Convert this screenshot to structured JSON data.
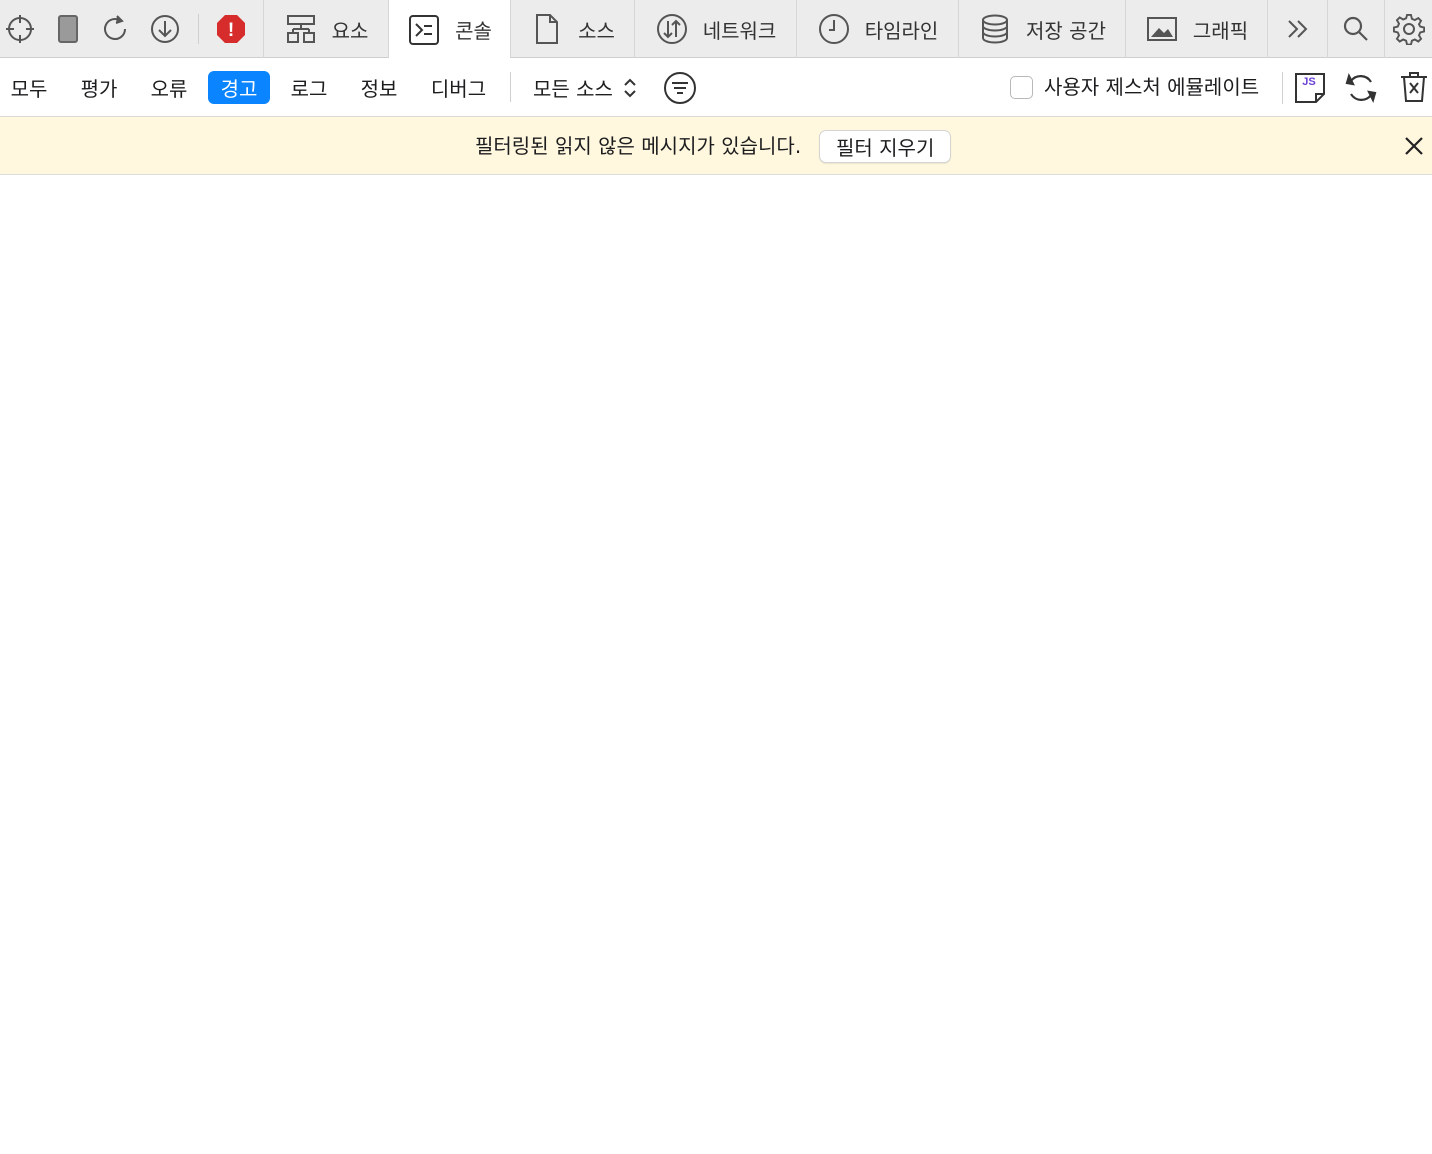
{
  "toolbar": {
    "icons": [
      "crosshair-icon",
      "device-icon",
      "reload-icon",
      "download-icon",
      "error-badge-icon"
    ],
    "error_badge": "!"
  },
  "tabs": [
    {
      "id": "elements",
      "label": "요소",
      "icon": "elements-icon"
    },
    {
      "id": "console",
      "label": "콘솔",
      "icon": "console-icon",
      "active": true
    },
    {
      "id": "sources",
      "label": "소스",
      "icon": "sources-icon"
    },
    {
      "id": "network",
      "label": "네트워크",
      "icon": "network-icon"
    },
    {
      "id": "timeline",
      "label": "타임라인",
      "icon": "timeline-icon"
    },
    {
      "id": "storage",
      "label": "저장 공간",
      "icon": "storage-icon"
    },
    {
      "id": "graphics",
      "label": "그래픽",
      "icon": "graphics-icon"
    }
  ],
  "tab_right_icons": [
    "more-tabs-icon",
    "search-icon",
    "settings-icon"
  ],
  "filters": {
    "levels": [
      "모두",
      "평가",
      "오류",
      "경고",
      "로그",
      "정보",
      "디버그"
    ],
    "active_level": "경고",
    "source_select": "모든 소스",
    "emulate_gesture_label": "사용자 제스처 에뮬레이트",
    "emulate_gesture_checked": false,
    "js_badge": "JS"
  },
  "banner": {
    "message": "필터링된 읽지 않은 메시지가 있습니다.",
    "clear_button": "필터 지우기"
  },
  "colors": {
    "accent": "#0a84ff",
    "error_red": "#d72c2c",
    "banner_bg": "#fff8df",
    "toolbar_bg": "#ececec"
  }
}
